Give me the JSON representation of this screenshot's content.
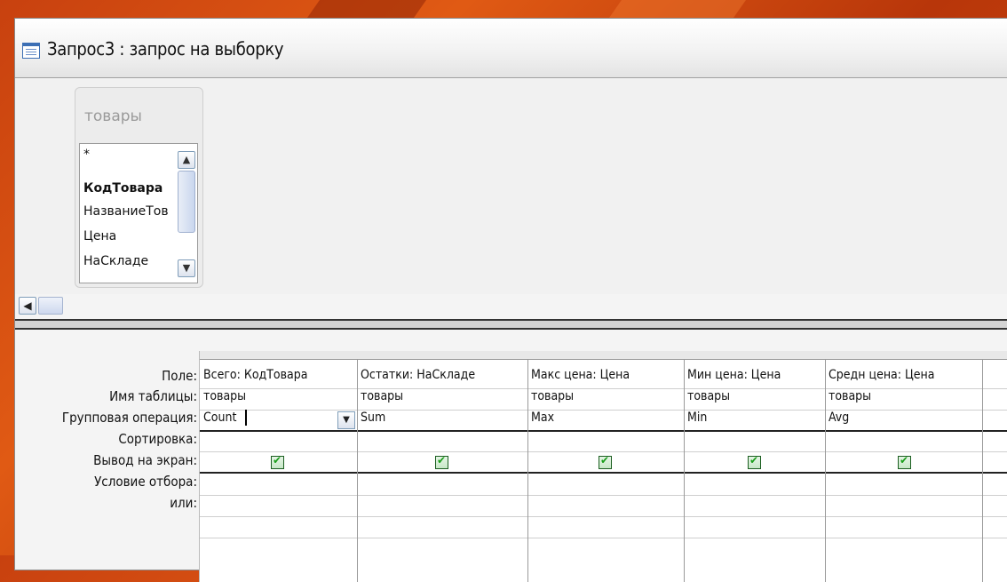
{
  "window": {
    "title": "Запрос3 : запрос на выборку"
  },
  "table": {
    "name": "товары",
    "fields": [
      "*",
      "КодТовара",
      "НазваниеТов",
      "Цена",
      "НаСкладе"
    ]
  },
  "row_labels": {
    "field": "Поле:",
    "table": "Имя таблицы:",
    "group": "Групповая операция:",
    "sort": "Сортировка:",
    "show": "Вывод на экран:",
    "criteria": "Условие отбора:",
    "or": "или:"
  },
  "columns": [
    {
      "field": "Всего: КодТовара",
      "table": "товары",
      "group": "Count",
      "show": true
    },
    {
      "field": "Остатки: НаСкладе",
      "table": "товары",
      "group": "Sum",
      "show": true
    },
    {
      "field": "Макс цена: Цена",
      "table": "товары",
      "group": "Max",
      "show": true
    },
    {
      "field": "Мин цена: Цена",
      "table": "товары",
      "group": "Min",
      "show": true
    },
    {
      "field": "Средн цена: Цена",
      "table": "товары",
      "group": "Avg",
      "show": true
    }
  ],
  "icons": {
    "title": "query-icon",
    "scroll_up": "chevron-up-icon",
    "scroll_down": "chevron-down-icon",
    "scroll_left": "chevron-left-icon",
    "dropdown": "chevron-down-icon",
    "checkbox": "checkmark-icon"
  },
  "colors": {
    "background": "#d44e10",
    "check": "#1a9e1a"
  }
}
